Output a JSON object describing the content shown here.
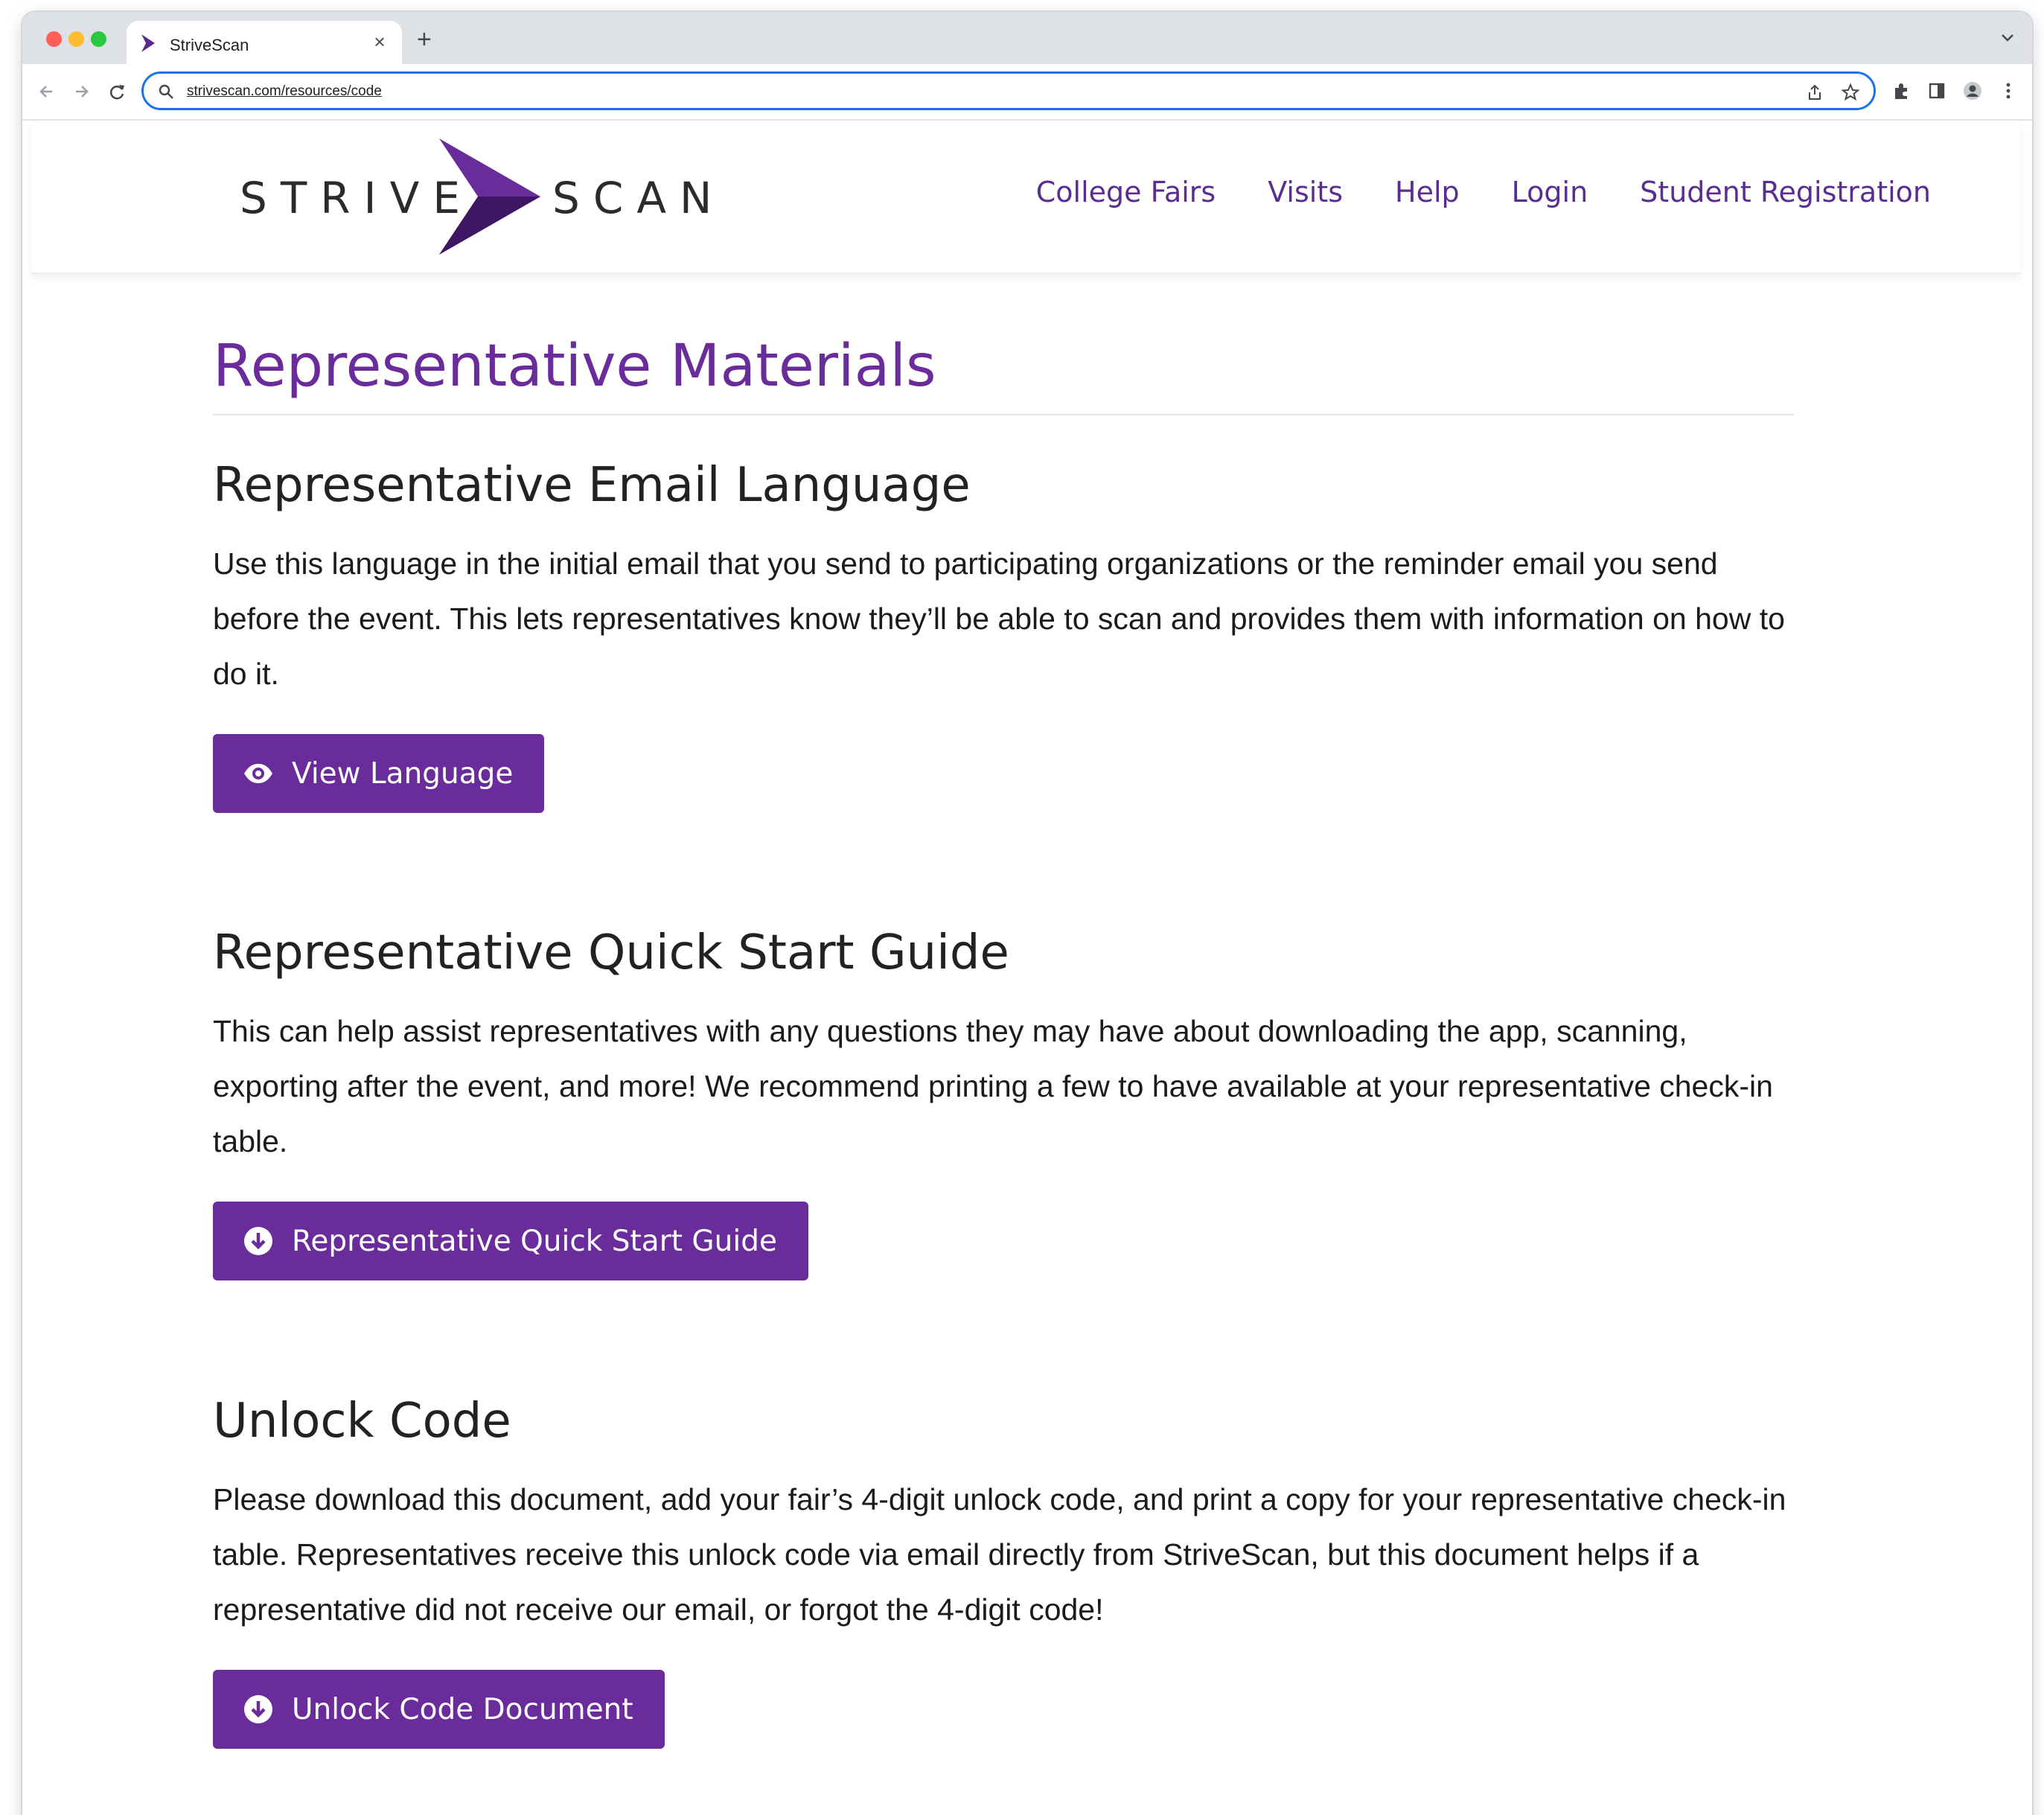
{
  "browser": {
    "tab_title": "StriveScan",
    "tab_close": "×",
    "new_tab": "+",
    "url": "strivescan.com/resources/code"
  },
  "header": {
    "logo_left": "STRIVE",
    "logo_right": "SCAN",
    "nav": [
      "College Fairs",
      "Visits",
      "Help",
      "Login",
      "Student Registration"
    ]
  },
  "main": {
    "title": "Representative Materials",
    "sections": [
      {
        "heading": "Representative Email Language",
        "body": "Use this language in the initial email that you send to participating organizations or the reminder email you send before the event. This lets representatives know they’ll be able to scan and provides them with information on how to do it.",
        "button": "View Language",
        "icon": "eye-icon"
      },
      {
        "heading": "Representative Quick Start Guide",
        "body": "This can help assist representatives with any questions they may have about downloading the app, scanning, exporting after the event, and more! We recommend printing a few to have available at your representative check-in table.",
        "button": "Representative Quick Start Guide",
        "icon": "download-circle-icon"
      },
      {
        "heading": "Unlock Code",
        "body": "Please download this document, add your fair’s 4-digit unlock code, and print a copy for your representative check-in table. Representatives receive this unlock code via email directly from StriveScan, but this document helps if a representative did not receive our email, or forgot the 4-digit code!",
        "button": "Unlock Code Document",
        "icon": "download-circle-icon"
      }
    ]
  },
  "colors": {
    "brand_purple": "#6a2c9a",
    "nav_purple": "#5a2d91",
    "omnibox_focus": "#1a73e8"
  }
}
